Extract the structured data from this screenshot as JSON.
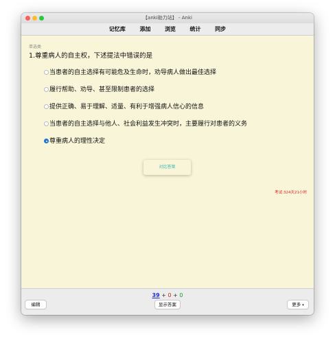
{
  "window": {
    "title": "【anki助力站】 - Anki"
  },
  "toolbar": {
    "items": [
      "记忆库",
      "添加",
      "浏览",
      "统计",
      "同步"
    ]
  },
  "card": {
    "type_label": "单选类",
    "question": "1.尊重病人的自主权，下述提法中错误的是",
    "options": [
      {
        "text": "当患者的自主选择有可能危及生命时，劝导病人做出最佳选择",
        "selected": false
      },
      {
        "text": "履行帮助、劝导、甚至限制患者的选择",
        "selected": false
      },
      {
        "text": "提供正确、易于理解、适量、有利于增强病人信心的信息",
        "selected": false
      },
      {
        "text": "当患者的自主选择与他人、社会利益发生冲突时，主要履行对患者的义务",
        "selected": false
      },
      {
        "text": "尊重病人的理性决定",
        "selected": true
      }
    ],
    "compare_button": "对比答案",
    "exam_timer": "考试:324天21小时"
  },
  "bottom": {
    "counts": {
      "new": "39",
      "sep1": " + ",
      "learn": "0",
      "sep2": " + ",
      "review": "0"
    },
    "edit_button": "编辑",
    "show_answer_button": "显示答案",
    "more_button": "更多"
  },
  "colors": {
    "card_bg": "#f8f5d8",
    "timer": "#e02020",
    "selected_radio": "#1f73d9",
    "compare_text": "#3fb8b0"
  }
}
